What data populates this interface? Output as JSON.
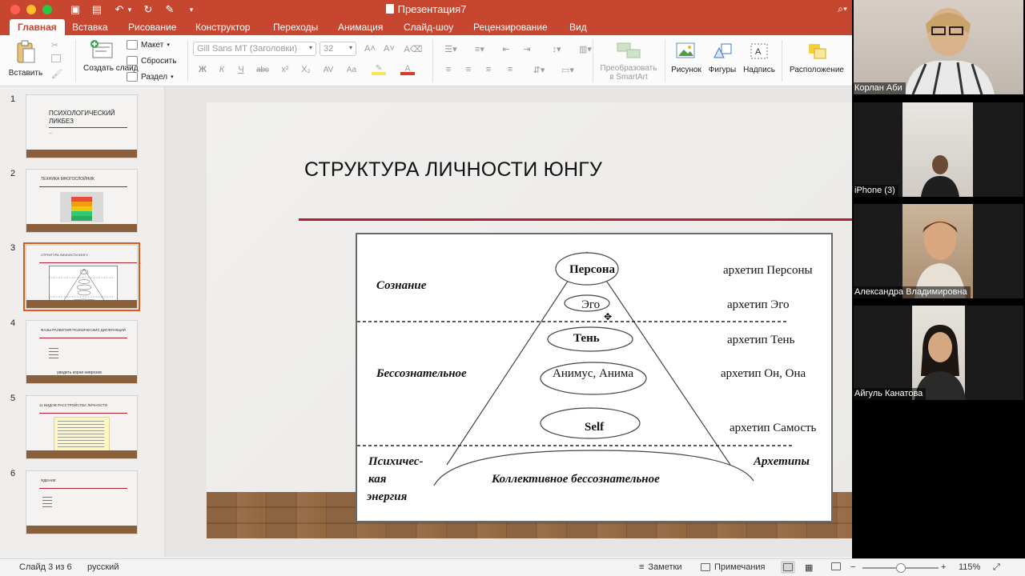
{
  "window": {
    "title": "Презентация7",
    "quick_access": [
      {
        "id": "sidebar",
        "icon": "sidebar-toggle-icon",
        "glyph": "▣"
      },
      {
        "id": "save",
        "icon": "save-icon",
        "glyph": "▤"
      },
      {
        "id": "undo",
        "icon": "undo-icon",
        "glyph": "↶"
      },
      {
        "id": "undo-more",
        "icon": "chevron-down-icon",
        "glyph": "▾"
      },
      {
        "id": "redo",
        "icon": "redo-icon",
        "glyph": "↻"
      },
      {
        "id": "edit",
        "icon": "edit-icon",
        "glyph": "✎"
      },
      {
        "id": "more",
        "icon": "chevron-down-icon",
        "glyph": "▾"
      }
    ]
  },
  "tabs": [
    {
      "label": "Главная",
      "active": true
    },
    {
      "label": "Вставка"
    },
    {
      "label": "Рисование"
    },
    {
      "label": "Конструктор"
    },
    {
      "label": "Переходы"
    },
    {
      "label": "Анимация"
    },
    {
      "label": "Слайд-шоу"
    },
    {
      "label": "Рецензирование"
    },
    {
      "label": "Вид"
    }
  ],
  "ribbon": {
    "paste_label": "Вставить",
    "new_slide_label": "Создать слайд",
    "layout_label": "Макет",
    "reset_label": "Сбросить",
    "section_label": "Раздел",
    "font_name": "Gill Sans MT (Заголовки)",
    "font_size": "32",
    "smartart_label": "Преобразовать в SmartArt",
    "picture_label": "Рисунок",
    "shapes_label": "Фигуры",
    "textbox_label": "Надпись",
    "arrange_label": "Расположение",
    "format_buttons": [
      "Ж",
      "К",
      "Ч",
      "abc",
      "x²",
      "X₂",
      "AV",
      "Aa"
    ],
    "accent": "#c6462f"
  },
  "thumbnails": [
    {
      "num": "1",
      "title": "ПСИХОЛОГИЧЕСКИЙ ЛИКБЕЗ",
      "sub": "—"
    },
    {
      "num": "2",
      "title": "ТЕХНИКА МНОГОСЛОЙНИК"
    },
    {
      "num": "3",
      "title": "СТРУКТУРА ЛИЧНОСТИ ЮНГУ",
      "selected": true
    },
    {
      "num": "4",
      "title": "ФАЗЫ РАЗВИТИЯ ПСИХИЧЕСКИХ ДИСФУНКЦИЙ",
      "foot": "увидеть корни неврозов"
    },
    {
      "num": "5",
      "title": "11 ВИДОВ РАССТРОЙСТВА ЛИЧНОСТИ"
    },
    {
      "num": "6",
      "title": "ЯДЕНИЕ"
    }
  ],
  "slide": {
    "title": "СТРУКТУРА ЛИЧНОСТИ ЮНГУ",
    "diagram": {
      "left_labels": {
        "consciousness": "Сознание",
        "unconscious": "Бессознательное",
        "psychic_energy_1": "Психичес-",
        "psychic_energy_2": "кая",
        "psychic_energy_3": "энергия"
      },
      "center_labels": {
        "persona": "Персона",
        "ego": "Эго",
        "shadow": "Тень",
        "animus_anima": "Анимус, Анима",
        "self": "Self",
        "collective": "Коллективное бессознательное"
      },
      "right_labels": {
        "persona": "архетип Персоны",
        "ego": "архетип Эго",
        "shadow": "архетип Тень",
        "animus_anima": "архетип Он, Она",
        "self": "архетип Самость",
        "archetypes": "Архетипы"
      }
    }
  },
  "status": {
    "slide_counter": "Слайд 3 из 6",
    "language": "русский",
    "notes_label": "Заметки",
    "comments_label": "Примечания",
    "zoom": "115%",
    "zoom_fraction": 0.5
  },
  "participants": [
    {
      "name": "Корлан Аби",
      "bg": "#cfc6bd"
    },
    {
      "name": "iPhone (3)",
      "bg": "#d8d3cc"
    },
    {
      "name": "Александра Владимировна",
      "bg": "#c9b39b"
    },
    {
      "name": "Айгуль Канатова",
      "bg": "#ddd6cf"
    }
  ]
}
